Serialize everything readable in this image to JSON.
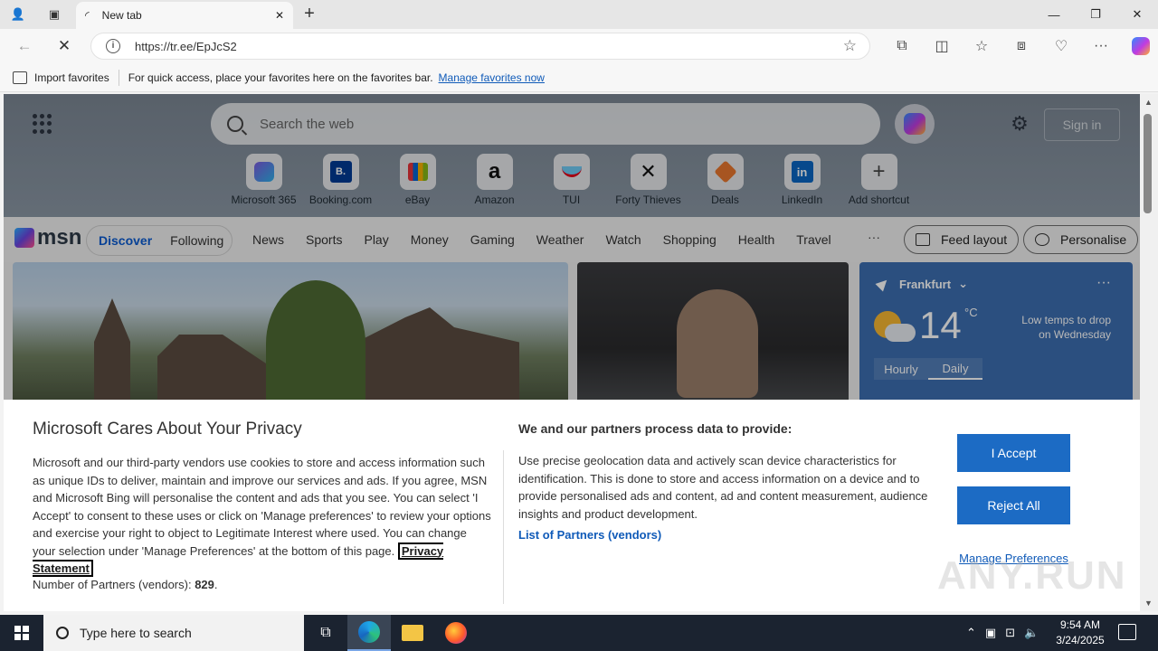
{
  "browser": {
    "tab_title": "New tab",
    "url": "https://tr.ee/EpJcS2",
    "favorites_bar": {
      "import_label": "Import favorites",
      "hint": "For quick access, place your favorites here on the favorites bar.",
      "manage_link": "Manage favorites now"
    }
  },
  "msn": {
    "search_placeholder": "Search the web",
    "sign_in": "Sign in",
    "shortcuts": [
      {
        "label": "Microsoft 365",
        "icon": "microsoft-365-icon"
      },
      {
        "label": "Booking.com",
        "icon": "booking-icon",
        "glyph": "B."
      },
      {
        "label": "eBay",
        "icon": "ebay-icon"
      },
      {
        "label": "Amazon",
        "icon": "amazon-icon",
        "glyph": "a"
      },
      {
        "label": "TUI",
        "icon": "tui-icon"
      },
      {
        "label": "Forty Thieves",
        "icon": "swords-icon",
        "glyph": "✕"
      },
      {
        "label": "Deals",
        "icon": "deals-icon"
      },
      {
        "label": "LinkedIn",
        "icon": "linkedin-icon",
        "glyph": "in"
      },
      {
        "label": "Add shortcut",
        "icon": "plus-icon",
        "glyph": "+"
      }
    ],
    "logo": "msn",
    "feed_tabs": {
      "discover": "Discover",
      "following": "Following"
    },
    "categories": [
      "News",
      "Sports",
      "Play",
      "Money",
      "Gaming",
      "Weather",
      "Watch",
      "Shopping",
      "Health",
      "Travel"
    ],
    "more": "···",
    "feed_layout": "Feed layout",
    "personalise": "Personalise",
    "weather": {
      "location": "Frankfurt",
      "temp": "14",
      "unit": "°C",
      "note": "Low temps to drop on Wednesday",
      "tabs": [
        "Hourly",
        "Daily"
      ]
    }
  },
  "privacy": {
    "title": "Microsoft Cares About Your Privacy",
    "body": "Microsoft and our third-party vendors use cookies to store and access information such as unique IDs to deliver, maintain and improve our services and ads. If you agree, MSN and Microsoft Bing will personalise the content and ads that you see. You can select 'I Accept' to consent to these uses or click on 'Manage preferences' to review your options and exercise your right to object to Legitimate Interest where used.  You can change your selection under 'Manage Preferences' at the bottom of this page.",
    "privacy_link": "Privacy Statement",
    "partners_label": "Number of Partners (vendors):",
    "partners_count": "829",
    "partners_suffix": ".",
    "mid_title": "We and our partners process data to provide:",
    "mid_body": "Use precise geolocation data and actively scan device characteristics for identification. This is done to store and access information on a device and to provide personalised ads and content, ad and content measurement, audience insights and product development.",
    "vendors_link": "List of Partners (vendors)",
    "accept": "I Accept",
    "reject": "Reject All",
    "manage": "Manage Preferences"
  },
  "watermark": "ANY.RUN",
  "taskbar": {
    "search_placeholder": "Type here to search",
    "time": "9:54 AM",
    "date": "3/24/2025"
  }
}
